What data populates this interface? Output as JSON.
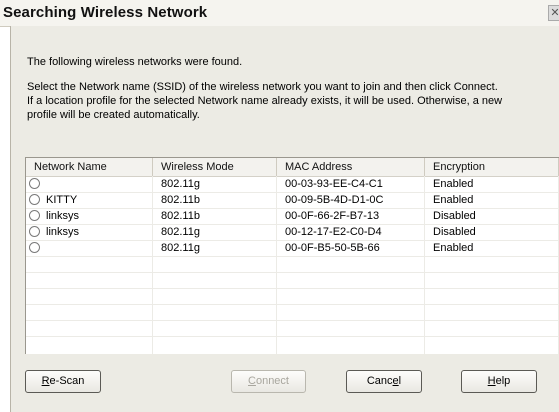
{
  "window": {
    "title": "Searching Wireless Network",
    "close_glyph": "✕"
  },
  "messages": {
    "found": "The following wireless networks were found.",
    "instructions": [
      "Select the Network name (SSID) of the wireless network you want to join and then click Connect.",
      "If a location profile for the selected Network name already exists, it will be used. Otherwise, a new",
      "profile will be created automatically."
    ]
  },
  "table": {
    "columns": [
      "Network Name",
      "Wireless Mode",
      "MAC Address",
      "Encryption"
    ],
    "rows": [
      {
        "name": "",
        "mode": "802.11g",
        "mac": "00-03-93-EE-C4-C1",
        "encryption": "Enabled"
      },
      {
        "name": "KITTY",
        "mode": "802.11b",
        "mac": "00-09-5B-4D-D1-0C",
        "encryption": "Enabled"
      },
      {
        "name": "linksys",
        "mode": "802.11b",
        "mac": "00-0F-66-2F-B7-13",
        "encryption": "Disabled"
      },
      {
        "name": "linksys",
        "mode": "802.11g",
        "mac": "00-12-17-E2-C0-D4",
        "encryption": "Disabled"
      },
      {
        "name": "",
        "mode": "802.11g",
        "mac": "00-0F-B5-50-5B-66",
        "encryption": "Enabled"
      }
    ],
    "empty_rows": 5
  },
  "buttons": {
    "rescan": {
      "label": "Re-Scan",
      "first": "R",
      "rest": "e-Scan"
    },
    "connect": {
      "label": "Connect",
      "first": "C",
      "rest": "onnect",
      "enabled": false
    },
    "cancel": {
      "label": "Cancel",
      "pre": "Canc",
      "mnemonic": "e",
      "post": "l"
    },
    "help": {
      "label": "Help",
      "first": "H",
      "rest": "elp"
    }
  },
  "colors": {
    "dialog_bg": "#ecebe4",
    "table_bg": "#ffffff",
    "disabled_text": "#a8a69e"
  }
}
